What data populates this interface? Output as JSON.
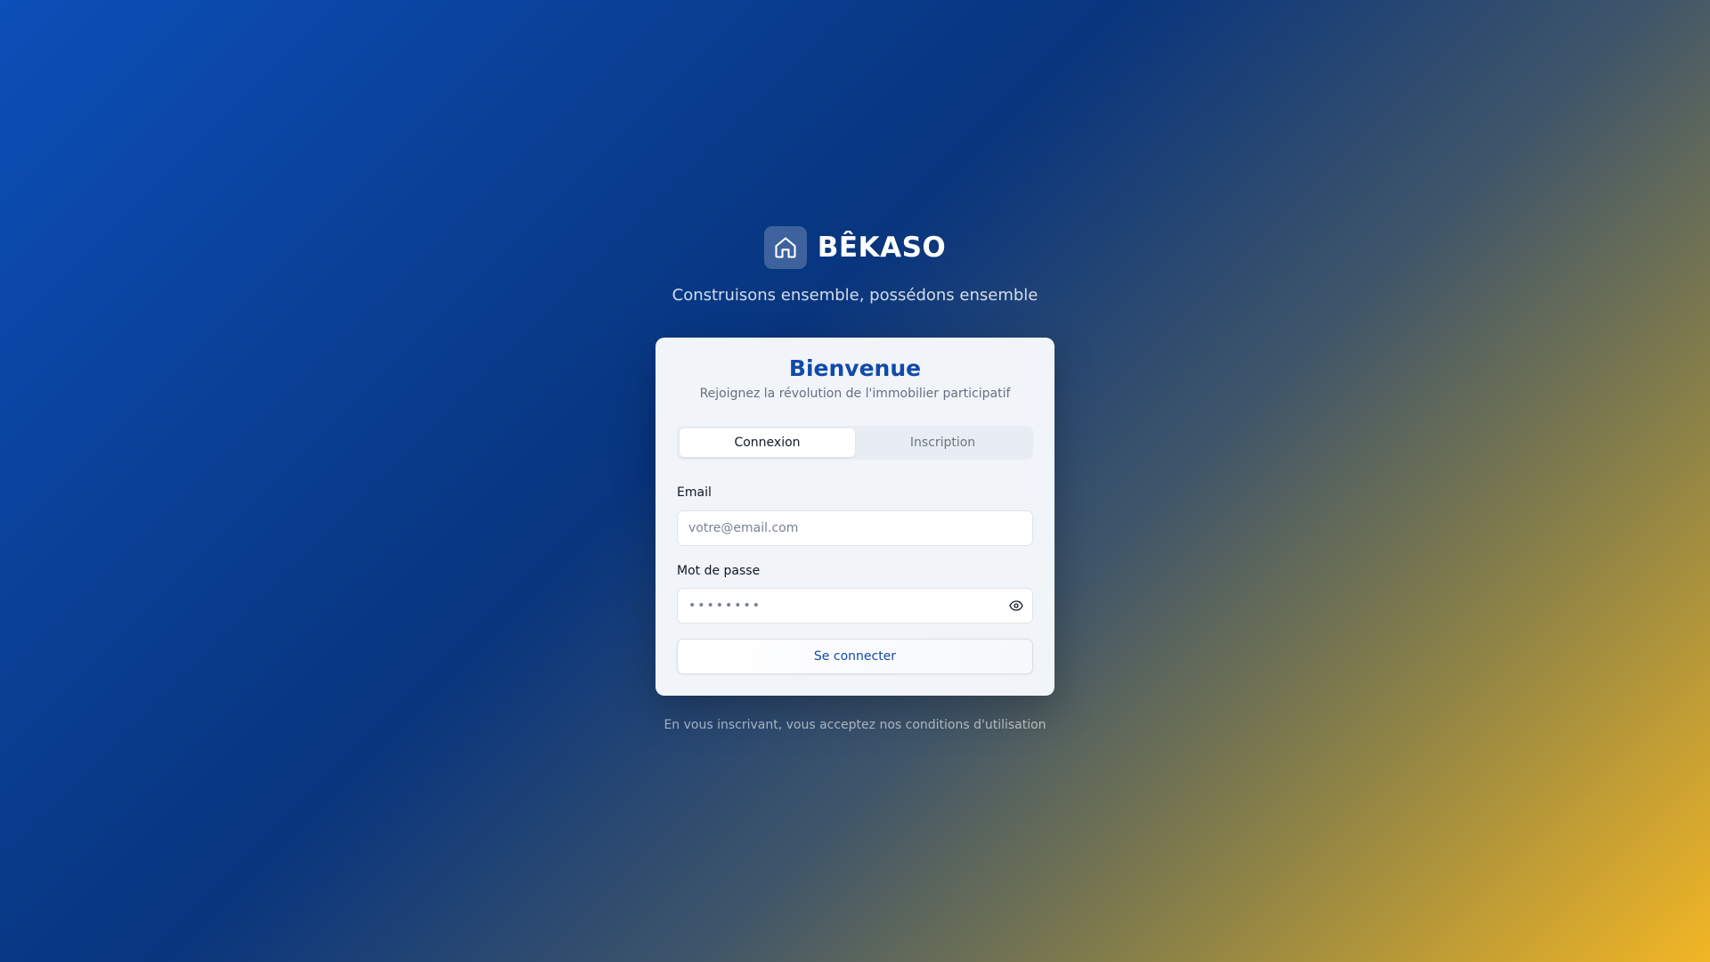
{
  "brand": {
    "name": "BÊKASO",
    "tagline": "Construisons ensemble, possédons ensemble",
    "logo_icon": "home-icon"
  },
  "card": {
    "title": "Bienvenue",
    "subtitle": "Rejoignez la révolution de l'immobilier participatif",
    "tabs": [
      {
        "label": "Connexion",
        "active": true
      },
      {
        "label": "Inscription",
        "active": false
      }
    ],
    "email": {
      "label": "Email",
      "placeholder": "votre@email.com",
      "value": ""
    },
    "password": {
      "label": "Mot de passe",
      "placeholder": "••••••••",
      "value": "",
      "toggle_icon": "eye-icon"
    },
    "submit_label": "Se connecter"
  },
  "footer": {
    "text": "En vous inscrivant, vous acceptez nos conditions d'utilisation"
  },
  "colors": {
    "brand_blue": "#114aa9",
    "background_start": "#0c4fb8",
    "background_end": "#f2b625"
  }
}
